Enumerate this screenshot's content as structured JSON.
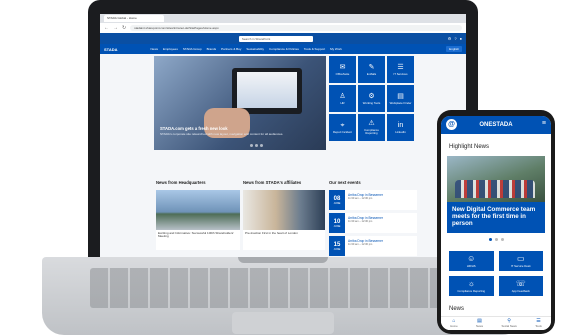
{
  "browser": {
    "tab_title": "STADA Global - Home",
    "url": "stadaint.sharepoint.com/sites/intranet-de/SitePages/Home.aspx"
  },
  "intranet": {
    "logo": "STADA",
    "search_placeholder": "Search in SharePoint",
    "nav": [
      "News",
      "Employees",
      "STADA Group",
      "Brands",
      "Partners & Buy",
      "Sustainability",
      "Compliance & Policies",
      "Tools & Support",
      "My Work"
    ],
    "language": "English",
    "hero": {
      "title": "STADA.com gets a fresh new look",
      "text": "STADA's corporate site relaunched with new layout, navigation and content for all audiences."
    },
    "tiles": [
      {
        "icon": "✉",
        "label": "OfficeSuite"
      },
      {
        "icon": "✎",
        "label": "E-Mails"
      },
      {
        "icon": "☰",
        "label": "IT Services"
      },
      {
        "icon": "♙",
        "label": "HR"
      },
      {
        "icon": "⚙",
        "label": "Working Tools"
      },
      {
        "icon": "▤",
        "label": "Workplace Finder"
      },
      {
        "icon": "⌖",
        "label": "Report Incident"
      },
      {
        "icon": "⚠",
        "label": "Compliance Reporting"
      },
      {
        "icon": "in",
        "label": "LinkedIn"
      }
    ],
    "sections": {
      "hq": "News from Headquarters",
      "affiliates": "News from STADA's affiliates",
      "events": "Our next events"
    },
    "hq_news": "Exciting and Informative: Successful 100th Shareholders' Meeting",
    "affiliate_news": "Pre-Inaction First in the heart of London",
    "events": [
      {
        "day": "08",
        "month": "JUNE",
        "name": "Arriba Drop in Bessemer",
        "meta": "11:30 am – 12:30 pm"
      },
      {
        "day": "10",
        "month": "JUNE",
        "name": "Arriba Drop in Bessemer",
        "meta": "11:30 am – 12:30 pm"
      },
      {
        "day": "15",
        "month": "JUNE",
        "name": "Arriba Drop in Bessemer",
        "meta": "11:30 am – 12:30 pm"
      }
    ]
  },
  "phone": {
    "app_title": "ONESTADA",
    "highlight_label": "Highlight News",
    "news_title": "New Digital Commerce team meets for the first time in person",
    "tiles": [
      {
        "icon": "☺",
        "label": "HR/HS"
      },
      {
        "icon": "▭",
        "label": "IT Service Desk"
      },
      {
        "icon": "☼",
        "label": "Compliance Reporting"
      },
      {
        "icon": "☏",
        "label": "App Feedback"
      }
    ],
    "news_label": "News",
    "bottom_nav": [
      {
        "icon": "⌂",
        "label": "Home"
      },
      {
        "icon": "▤",
        "label": "News"
      },
      {
        "icon": "⚲",
        "label": "Social News"
      },
      {
        "icon": "☰",
        "label": "Tools"
      }
    ]
  }
}
